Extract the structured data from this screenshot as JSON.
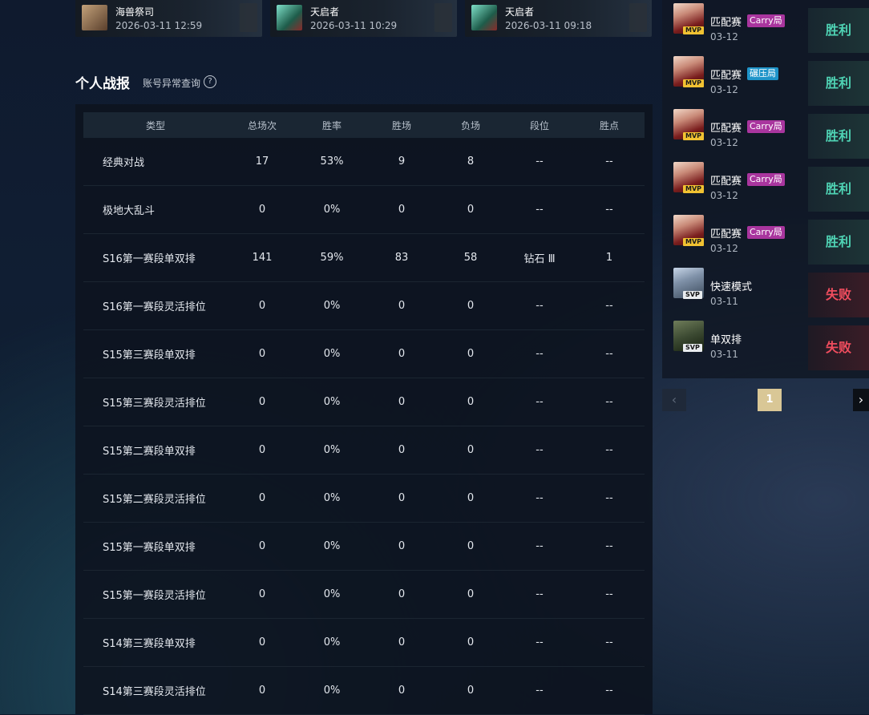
{
  "recent_games": [
    {
      "name": "海兽祭司",
      "time": "2026-03-11 12:59"
    },
    {
      "name": "天启者",
      "time": "2026-03-11 10:29"
    },
    {
      "name": "天启者",
      "time": "2026-03-11 09:18"
    }
  ],
  "section": {
    "title": "个人战报",
    "link": "账号异常查询",
    "help": "?"
  },
  "stats_table": {
    "headers": [
      "类型",
      "总场次",
      "胜率",
      "胜场",
      "负场",
      "段位",
      "胜点"
    ],
    "rows": [
      [
        "经典对战",
        "17",
        "53%",
        "9",
        "8",
        "--",
        "--"
      ],
      [
        "极地大乱斗",
        "0",
        "0%",
        "0",
        "0",
        "--",
        "--"
      ],
      [
        "S16第一赛段单双排",
        "141",
        "59%",
        "83",
        "58",
        "钻石 Ⅲ",
        "1"
      ],
      [
        "S16第一赛段灵活排位",
        "0",
        "0%",
        "0",
        "0",
        "--",
        "--"
      ],
      [
        "S15第三赛段单双排",
        "0",
        "0%",
        "0",
        "0",
        "--",
        "--"
      ],
      [
        "S15第三赛段灵活排位",
        "0",
        "0%",
        "0",
        "0",
        "--",
        "--"
      ],
      [
        "S15第二赛段单双排",
        "0",
        "0%",
        "0",
        "0",
        "--",
        "--"
      ],
      [
        "S15第二赛段灵活排位",
        "0",
        "0%",
        "0",
        "0",
        "--",
        "--"
      ],
      [
        "S15第一赛段单双排",
        "0",
        "0%",
        "0",
        "0",
        "--",
        "--"
      ],
      [
        "S15第一赛段灵活排位",
        "0",
        "0%",
        "0",
        "0",
        "--",
        "--"
      ],
      [
        "S14第三赛段单双排",
        "0",
        "0%",
        "0",
        "0",
        "--",
        "--"
      ],
      [
        "S14第三赛段灵活排位",
        "0",
        "0%",
        "0",
        "0",
        "--",
        "--"
      ]
    ]
  },
  "matches": [
    {
      "mode": "匹配赛",
      "tag": "Carry局",
      "tag_type": "carry",
      "badge": "MVP",
      "date": "03-12",
      "result": "胜利",
      "result_type": "win",
      "hero": "h1"
    },
    {
      "mode": "匹配赛",
      "tag": "碾压局",
      "tag_type": "crush",
      "badge": "MVP",
      "date": "03-12",
      "result": "胜利",
      "result_type": "win",
      "hero": "h1"
    },
    {
      "mode": "匹配赛",
      "tag": "Carry局",
      "tag_type": "carry",
      "badge": "MVP",
      "date": "03-12",
      "result": "胜利",
      "result_type": "win",
      "hero": "h1"
    },
    {
      "mode": "匹配赛",
      "tag": "Carry局",
      "tag_type": "carry",
      "badge": "MVP",
      "date": "03-12",
      "result": "胜利",
      "result_type": "win",
      "hero": "h1"
    },
    {
      "mode": "匹配赛",
      "tag": "Carry局",
      "tag_type": "carry",
      "badge": "MVP",
      "date": "03-12",
      "result": "胜利",
      "result_type": "win",
      "hero": "h1"
    },
    {
      "mode": "快速模式",
      "tag": "",
      "tag_type": "",
      "badge": "SVP",
      "date": "03-11",
      "result": "失败",
      "result_type": "loss",
      "hero": "h2"
    },
    {
      "mode": "单双排",
      "tag": "",
      "tag_type": "",
      "badge": "SVP",
      "date": "03-11",
      "result": "失败",
      "result_type": "loss",
      "hero": "h3"
    }
  ],
  "pagination": {
    "prev": "‹",
    "current": "1",
    "next": "›"
  }
}
